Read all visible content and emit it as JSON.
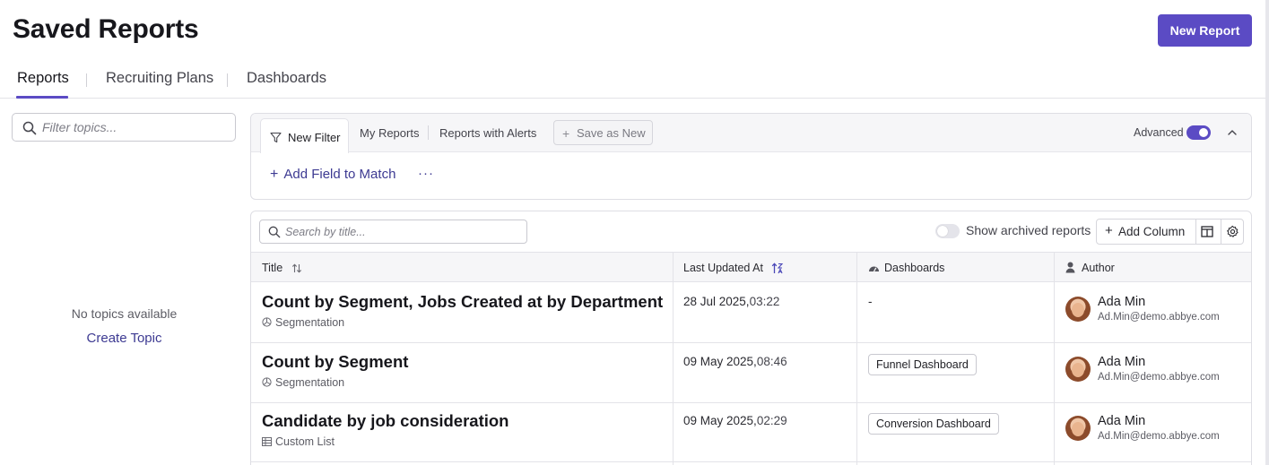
{
  "header": {
    "title": "Saved Reports",
    "new_report_label": "New Report"
  },
  "tabs": [
    {
      "label": "Reports",
      "active": true
    },
    {
      "label": "Recruiting Plans",
      "active": false
    },
    {
      "label": "Dashboards",
      "active": false
    }
  ],
  "sidebar": {
    "filter_placeholder": "Filter topics...",
    "empty_text": "No topics available",
    "create_label": "Create Topic"
  },
  "filters": {
    "tabs": [
      "New Filter",
      "My Reports",
      "Reports with Alerts"
    ],
    "active_tab": "New Filter",
    "save_as_new_label": "Save as New",
    "advanced_label": "Advanced",
    "advanced_enabled": true,
    "add_field_label": "Add Field to Match",
    "more_label": "···"
  },
  "table": {
    "search_placeholder": "Search by title...",
    "archived_label": "Show archived reports",
    "archived_enabled": false,
    "add_column_label": "Add Column",
    "columns": [
      "Title",
      "Last Updated At",
      "Dashboards",
      "Author"
    ],
    "rows": [
      {
        "title": "Count by Segment, Jobs Created at by Department",
        "type": "Segmentation",
        "date": "28 Jul 2025,",
        "time": "03:22",
        "dashboard": "-",
        "author_name": "Ada Min",
        "author_email": "Ad.Min@demo.abbye.com"
      },
      {
        "title": "Count by Segment",
        "type": "Segmentation",
        "date": "09 May 2025,",
        "time": "08:46",
        "dashboard": "Funnel Dashboard",
        "author_name": "Ada Min",
        "author_email": "Ad.Min@demo.abbye.com"
      },
      {
        "title": "Candidate by job consideration",
        "type": "Custom List",
        "date": "09 May 2025,",
        "time": "02:29",
        "dashboard": "Conversion Dashboard",
        "author_name": "Ada Min",
        "author_email": "Ad.Min@demo.abbye.com"
      }
    ]
  },
  "colors": {
    "accent": "#5b4bc4",
    "link": "#3d3a92",
    "border": "#dedee4",
    "header_bg": "#f6f6f8"
  },
  "icons": [
    "search-icon",
    "filter-icon",
    "plus-icon",
    "chevron-up-icon",
    "columns-icon",
    "gear-icon",
    "sort-icon",
    "sort-desc-icon",
    "dashboard-icon",
    "user-icon",
    "segmentation-icon",
    "table-icon"
  ]
}
